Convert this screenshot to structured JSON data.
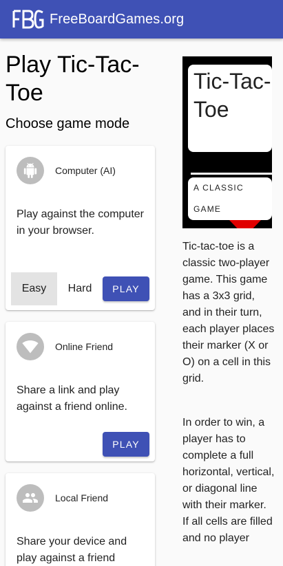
{
  "appbar": {
    "brand": "FreeBoardGames.org",
    "logo_text": "FBG",
    "color": "#3f51b5"
  },
  "page": {
    "title": "Play Tic-Tac-Toe",
    "subtitle": "Choose game mode"
  },
  "modes": [
    {
      "title": "Computer (AI)",
      "icon": "android-icon",
      "description": "Play against the computer in your browser.",
      "difficulty": [
        "Easy",
        "Hard"
      ],
      "selected": "Easy",
      "play_label": "PLAY"
    },
    {
      "title": "Online Friend",
      "icon": "wifi-icon",
      "description": "Share a link and play against a friend online.",
      "play_label": "PLAY"
    },
    {
      "title": "Local Friend",
      "icon": "people-icon",
      "description": "Share your device and play against a friend"
    }
  ],
  "thumbnail": {
    "title": "Tic-Tac-Toe",
    "subtitle": "A CLASSIC GAME"
  },
  "description": [
    "Tic-tac-toe is a classic two-player game. This game has a 3x3 grid, and in their turn, each player places their marker (X or O) on a cell in this grid.",
    "In order to win, a player has to complete a full horizontal, vertical, or diagonal line with their marker. If all cells are filled and no player"
  ]
}
